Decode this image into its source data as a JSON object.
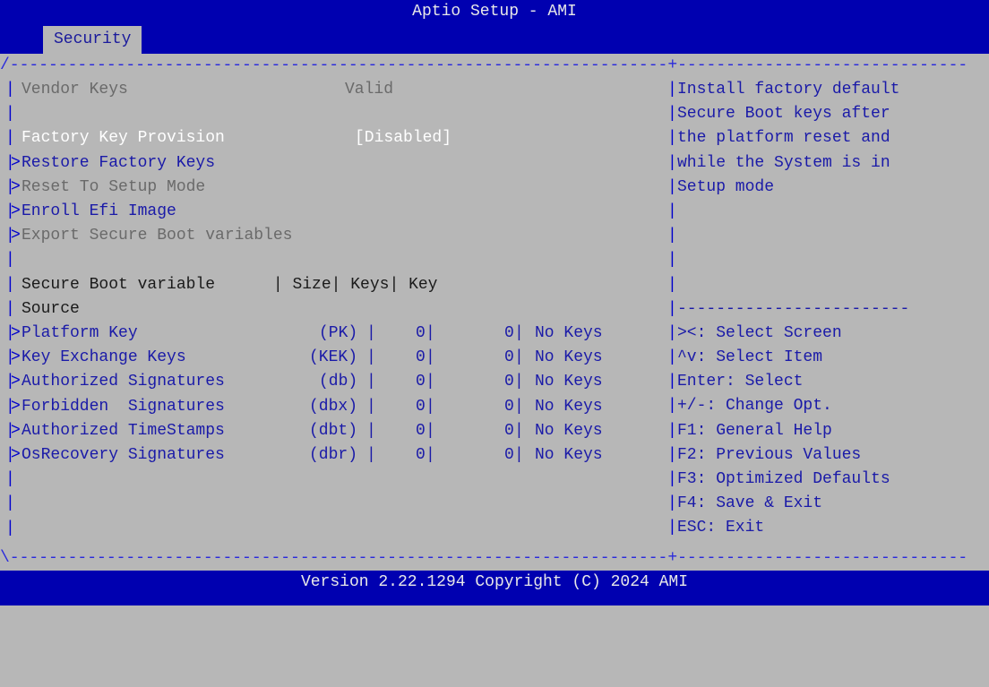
{
  "header": {
    "title": "Aptio Setup - AMI",
    "active_tab": "Security"
  },
  "frame": {
    "top_line": "/--------------------------------------------------------------------+------------------------------",
    "bottom_line": "\\--------------------------------------------------------------------+------------------------------"
  },
  "main": {
    "vendor_keys": {
      "label": "Vendor Keys",
      "value": "Valid"
    },
    "factory_key_provision": {
      "label": "Factory Key Provision",
      "value": "[Disabled]"
    },
    "menu_links": [
      {
        "label": "Restore Factory Keys",
        "enabled": true
      },
      {
        "label": "Reset To Setup Mode",
        "enabled": false
      },
      {
        "label": "Enroll Efi Image",
        "enabled": true
      },
      {
        "label": "Export Secure Boot variables",
        "enabled": false
      }
    ],
    "table": {
      "header_line1": "Secure Boot variable      | Size| Keys| Key",
      "header_line2": "Source",
      "rows": [
        {
          "name": "Platform Key",
          "abbr": "(PK)",
          "size": "0",
          "keys": "0",
          "source": "No Keys"
        },
        {
          "name": "Key Exchange Keys",
          "abbr": "(KEK)",
          "size": "0",
          "keys": "0",
          "source": "No Keys"
        },
        {
          "name": "Authorized Signatures",
          "abbr": "(db)",
          "size": "0",
          "keys": "0",
          "source": "No Keys"
        },
        {
          "name": "Forbidden  Signatures",
          "abbr": "(dbx)",
          "size": "0",
          "keys": "0",
          "source": "No Keys"
        },
        {
          "name": "Authorized TimeStamps",
          "abbr": "(dbt)",
          "size": "0",
          "keys": "0",
          "source": "No Keys"
        },
        {
          "name": "OsRecovery Signatures",
          "abbr": "(dbr)",
          "size": "0",
          "keys": "0",
          "source": "No Keys"
        }
      ]
    }
  },
  "help": {
    "description": [
      "Install factory default",
      "Secure Boot keys after",
      "the platform reset and",
      "while the System is in",
      "Setup mode"
    ],
    "separator": "------------------------",
    "keys": [
      "><: Select Screen",
      "^v: Select Item",
      "Enter: Select",
      "+/-: Change Opt.",
      "F1: General Help",
      "F2: Previous Values",
      "F3: Optimized Defaults",
      "F4: Save & Exit",
      "ESC: Exit"
    ]
  },
  "footer": {
    "text": "Version 2.22.1294 Copyright (C) 2024 AMI"
  },
  "colors": {
    "bar": "#0000b0",
    "panel": "#b7b7b7",
    "link": "#1a1aa8",
    "disabled": "#6a6a6a",
    "selected": "#ffffff"
  }
}
